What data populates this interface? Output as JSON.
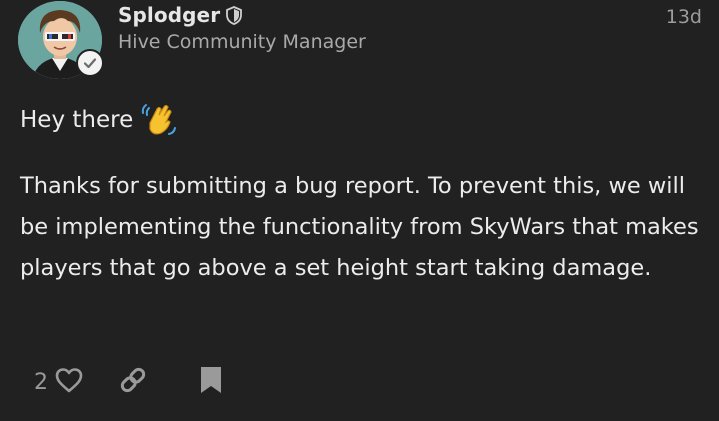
{
  "post": {
    "author": {
      "username": "Splodger",
      "title": "Hive Community Manager",
      "moderator_badge_icon": "shield-icon",
      "verified_icon": "checkmark-icon"
    },
    "timestamp": "13d",
    "greeting": {
      "text": "Hey there",
      "emoji_icon": "waving-hand-icon"
    },
    "body": "Thanks for submitting a bug report. To prevent this, we will be implementing the functionality from SkyWars that makes players that go above a set height start taking damage.",
    "actions": {
      "like_count": "2",
      "like_icon": "heart-icon",
      "share_icon": "link-icon",
      "bookmark_icon": "bookmark-icon"
    }
  },
  "colors": {
    "background": "#212121",
    "text_primary": "#ececec",
    "text_secondary": "#a9a9a9",
    "icon_muted": "#9a9a9a"
  }
}
